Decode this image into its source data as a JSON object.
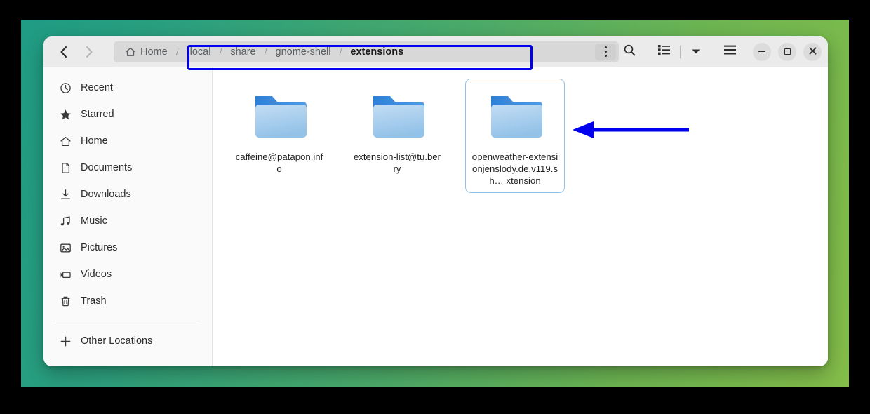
{
  "desktop": {
    "wallpaper_gradient_from": "#1f9c84",
    "wallpaper_gradient_to": "#84bd49"
  },
  "header": {
    "back_label": "Back",
    "forward_label": "Forward",
    "menu_label": "Path options",
    "search_label": "Search",
    "view_list_label": "List view",
    "view_dropdown_label": "View options",
    "main_menu_label": "Main menu",
    "minimize_label": "Minimize",
    "maximize_label": "Maximize",
    "close_label": "Close"
  },
  "breadcrumb": {
    "items": [
      {
        "label": "Home",
        "icon": "home-icon",
        "current": false
      },
      {
        "label": ".local",
        "icon": "",
        "current": false
      },
      {
        "label": "share",
        "icon": "",
        "current": false
      },
      {
        "label": "gnome-shell",
        "icon": "",
        "current": false
      },
      {
        "label": "extensions",
        "icon": "",
        "current": true
      }
    ],
    "separator": "/"
  },
  "annotations": {
    "highlight_color": "#0000ee",
    "arrow_color": "#0000ee",
    "arrow_direction": "left",
    "highlight_target": "breadcrumb-path-bar",
    "arrow_target": "openweather-folder"
  },
  "sidebar": {
    "items": [
      {
        "label": "Recent",
        "icon": "clock-icon"
      },
      {
        "label": "Starred",
        "icon": "star-icon"
      },
      {
        "label": "Home",
        "icon": "home-icon"
      },
      {
        "label": "Documents",
        "icon": "document-icon"
      },
      {
        "label": "Downloads",
        "icon": "download-icon"
      },
      {
        "label": "Music",
        "icon": "music-note-icon"
      },
      {
        "label": "Pictures",
        "icon": "picture-icon"
      },
      {
        "label": "Videos",
        "icon": "video-icon"
      },
      {
        "label": "Trash",
        "icon": "trash-icon"
      }
    ],
    "footer": [
      {
        "label": "Other Locations",
        "icon": "plus-icon"
      }
    ]
  },
  "files": {
    "items": [
      {
        "name": "caffeine@patapon.info",
        "type": "folder",
        "selected": false
      },
      {
        "name": "extension-list@tu.berry",
        "type": "folder",
        "selected": false
      },
      {
        "name": "openweather-extensionjenslody.de.v119.sh… xtension",
        "type": "folder",
        "selected": true
      }
    ]
  }
}
